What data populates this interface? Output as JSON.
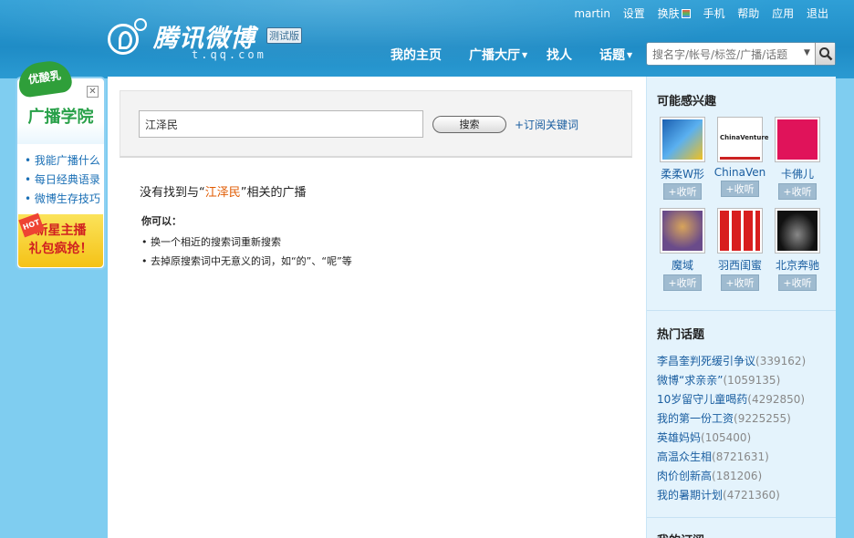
{
  "header": {
    "logo_name": "腾讯微博",
    "logo_badge": "测试版",
    "logo_sub": "t.qq.com",
    "top_links": {
      "user": "martin",
      "settings": "设置",
      "skin": "换肤",
      "mobile": "手机",
      "help": "帮助",
      "apps": "应用",
      "logout": "退出"
    },
    "nav": {
      "home": "我的主页",
      "hall": "广播大厅",
      "find": "找人",
      "topics": "话题"
    },
    "search_placeholder": "搜名字/帐号/标签/广播/话题"
  },
  "left_ad": {
    "brand": "优酸乳",
    "title": "广播学院",
    "links": [
      "我能广播什么",
      "每日经典语录",
      "微博生存技巧"
    ],
    "hot_badge": "HOT",
    "promo_line1": "新星主播",
    "promo_line2": "礼包疯抢！"
  },
  "search": {
    "query": "江泽民",
    "button": "搜索",
    "subscribe": "+订阅关键词"
  },
  "no_result": {
    "prefix": "没有找到与“",
    "keyword": "江泽民",
    "suffix": "”相关的广播",
    "tips_heading": "你可以：",
    "tips": [
      "• 换一个相近的搜索词重新搜索",
      "• 去掉原搜索词中无意义的词，如“的”、“呢”等"
    ]
  },
  "sidebar": {
    "interest_title": "可能感兴趣",
    "follow_label": "+收听",
    "people": [
      {
        "name": "柔柔W形",
        "color": "#3a7fd0"
      },
      {
        "name": "ChinaVen",
        "color": "#ffffff"
      },
      {
        "name": "卡佛儿",
        "color": "#e0135a"
      },
      {
        "name": "魔域",
        "color": "#6a4b8a"
      },
      {
        "name": "羽西闺蜜",
        "color": "#d81e1e"
      },
      {
        "name": "北京奔驰",
        "color": "#1a1a1a"
      }
    ],
    "avatar_text": {
      "chinaventure": "ChinaVenture"
    },
    "hot_title": "热门话题",
    "topics": [
      {
        "name": "李昌奎判死缓引争议",
        "count": "(339162)"
      },
      {
        "name": "微博“求亲亲”",
        "count": "(1059135)"
      },
      {
        "name": "10岁留守儿童喝药",
        "count": "(4292850)"
      },
      {
        "name": "我的第一份工资",
        "count": "(9225255)"
      },
      {
        "name": "英雄妈妈",
        "count": "(105400)"
      },
      {
        "name": "高温众生相",
        "count": "(8721631)"
      },
      {
        "name": "肉价创新高",
        "count": "(181206)"
      },
      {
        "name": "我的暑期计划",
        "count": "(4721360)"
      }
    ],
    "next_title": "我的订阅"
  }
}
